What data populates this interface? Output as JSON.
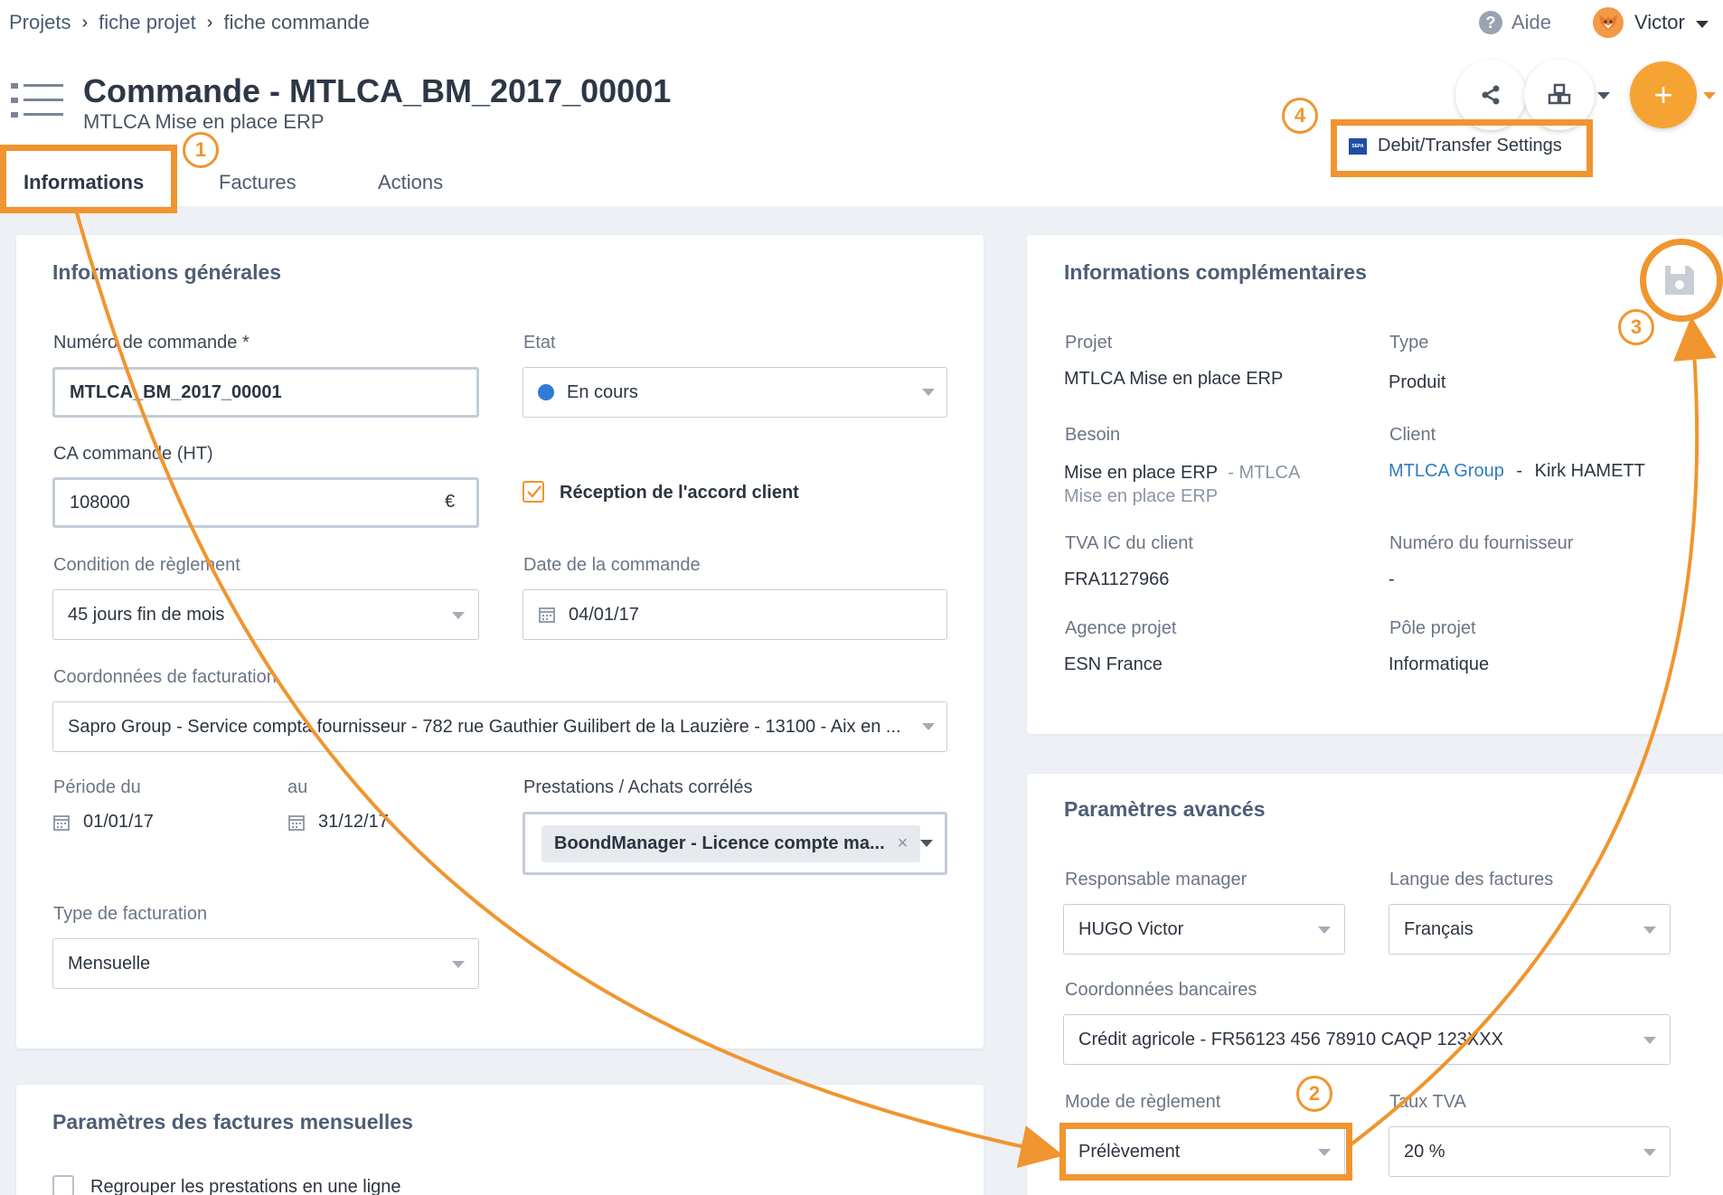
{
  "breadcrumb": {
    "items": [
      "Projets",
      "fiche projet",
      "fiche commande"
    ]
  },
  "topbar": {
    "help_label": "Aide",
    "user_name": "Victor"
  },
  "header": {
    "title": "Commande - MTLCA_BM_2017_00001",
    "subtitle": "MTLCA Mise en place ERP"
  },
  "tabs": [
    {
      "label": "Informations",
      "active": true
    },
    {
      "label": "Factures"
    },
    {
      "label": "Actions"
    }
  ],
  "toolbar": {
    "settings_label": "Debit/Transfer Settings",
    "settings_badge": "SEPA"
  },
  "annotations": {
    "one": "1",
    "two": "2",
    "three": "3",
    "four": "4",
    "accent_color": "#f0952f"
  },
  "general": {
    "title": "Informations générales",
    "order_number_label": "Numéro de commande *",
    "order_number_value": "MTLCA_BM_2017_00001",
    "state_label": "Etat",
    "state_value": "En cours",
    "state_color": "#2f7bd6",
    "revenue_label": "CA commande (HT)",
    "revenue_value": "108000",
    "currency": "€",
    "client_ack_label": "Réception de l'accord client",
    "client_ack_checked": true,
    "payment_condition_label": "Condition de règlement",
    "payment_condition_value": "45 jours fin de mois",
    "order_date_label": "Date de la commande",
    "order_date_value": "04/01/17",
    "billing_label": "Coordonnées de facturation",
    "billing_value": "Sapro Group - Service compta fournisseur - 782 rue Gauthier Guilibert de la Lauzière - 13100 - Aix en ...",
    "period_from_label": "Période du",
    "period_from_value": "01/01/17",
    "period_to_label": "au",
    "period_to_value": "31/12/17",
    "services_label": "Prestations / Achats corrélés",
    "services_tag": "BoondManager - Licence compte ma...",
    "billing_type_label": "Type de facturation",
    "billing_type_value": "Mensuelle"
  },
  "complementary": {
    "title": "Informations complémentaires",
    "project_label": "Projet",
    "project_value": "MTLCA Mise en place ERP",
    "type_label": "Type",
    "type_value": "Produit",
    "need_label": "Besoin",
    "need_value": "Mise en place ERP",
    "need_suffix": "- MTLCA",
    "need_suffix2": "Mise en place ERP",
    "client_label": "Client",
    "client_company": "MTLCA Group",
    "client_sep": "-",
    "client_contact": "Kirk HAMETT",
    "vat_label": "TVA IC du client",
    "vat_value": "FRA1127966",
    "supplier_label": "Numéro du fournisseur",
    "supplier_value": "-",
    "agency_label": "Agence projet",
    "agency_value": "ESN France",
    "pole_label": "Pôle projet",
    "pole_value": "Informatique"
  },
  "advanced": {
    "title": "Paramètres avancés",
    "manager_label": "Responsable manager",
    "manager_value": "HUGO Victor",
    "language_label": "Langue des factures",
    "language_value": "Français",
    "bank_label": "Coordonnées bancaires",
    "bank_value": "Crédit agricole - FR56123 456 78910 CAQP 123XXX",
    "payment_mode_label": "Mode de règlement",
    "payment_mode_value": "Prélèvement",
    "vat_rate_label": "Taux TVA",
    "vat_rate_value": "20 %"
  },
  "monthly": {
    "title": "Paramètres des factures mensuelles",
    "group_label": "Regrouper les prestations en une ligne"
  }
}
